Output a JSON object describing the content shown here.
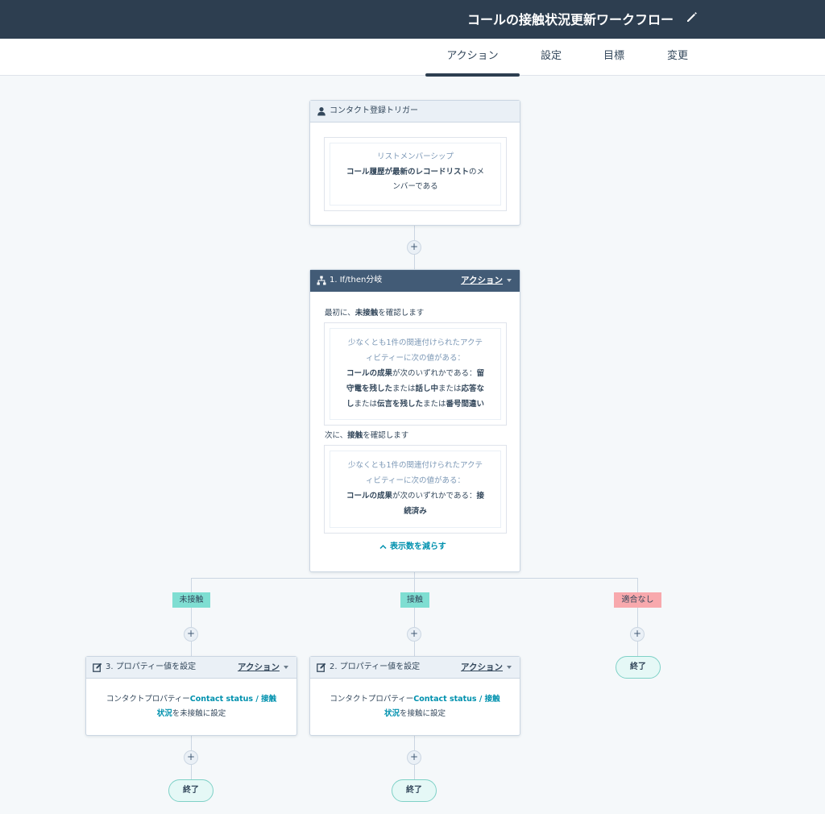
{
  "header": {
    "title": "コールの接触状況更新ワークフロー"
  },
  "tabs": [
    {
      "label": "アクション",
      "active": true
    },
    {
      "label": "設定"
    },
    {
      "label": "目標"
    },
    {
      "label": "変更"
    }
  ],
  "trigger": {
    "title": "コンタクト登録トリガー",
    "filter_label": "リストメンバーシップ",
    "filter_bold": "コール履歴が最新のレコードリスト",
    "filter_suffix_1": "のメ",
    "filter_suffix_2": "ンバーである"
  },
  "branch": {
    "title": "1. If/then分岐",
    "action_label": "アクション",
    "first_prefix": "最初に、",
    "first_bold": "未接触",
    "first_suffix": "を確認します",
    "cond1_muted_1": "少なくとも1件の関連付けられたアクテ",
    "cond1_muted_2": "ィビティーに次の値がある：",
    "cond1_l1_a": "コールの成果",
    "cond1_l1_b": "が次のいずれかである：",
    "cond1_l1_c": "留",
    "cond1_l2_a": "守電を残した",
    "cond1_l2_b": "または",
    "cond1_l2_c": "話し中",
    "cond1_l2_d": "または",
    "cond1_l2_e": "応答な",
    "cond1_l3_a": "し",
    "cond1_l3_b": "または",
    "cond1_l3_c": "伝言を残した",
    "cond1_l3_d": "または",
    "cond1_l3_e": "番号間違い",
    "second_prefix": "次に、",
    "second_bold": "接触",
    "second_suffix": "を確認します",
    "cond2_muted_1": "少なくとも1件の関連付けられたアクテ",
    "cond2_muted_2": "ィビティーに次の値がある：",
    "cond2_l1_a": "コールの成果",
    "cond2_l1_b": "が次のいずれかである：",
    "cond2_l1_c": "接",
    "cond2_l2_a": "続済み",
    "collapse_label": "表示数を減らす"
  },
  "branches": {
    "left": "未接触",
    "middle": "接触",
    "right": "適合なし"
  },
  "action_left": {
    "title": "3. プロパティー値を設定",
    "action_label": "アクション",
    "line1_prefix": "コンタクトプロパティー",
    "line1_link": "Contact status / 接触",
    "line2_link": "状況",
    "line2_suffix": "を未接触に設定"
  },
  "action_middle": {
    "title": "2. プロパティー値を設定",
    "action_label": "アクション",
    "line1_prefix": "コンタクトプロパティー",
    "line1_link": "Contact status / 接触",
    "line2_link": "状況",
    "line2_suffix": "を接触に設定"
  },
  "end_label": "終了",
  "plus": "+",
  "colors": {
    "header_bg": "#2d3e50",
    "branch_header_bg": "#425b76",
    "link": "#0091ae",
    "badge_green": "#7fded2",
    "badge_red": "#f8a9ad"
  }
}
